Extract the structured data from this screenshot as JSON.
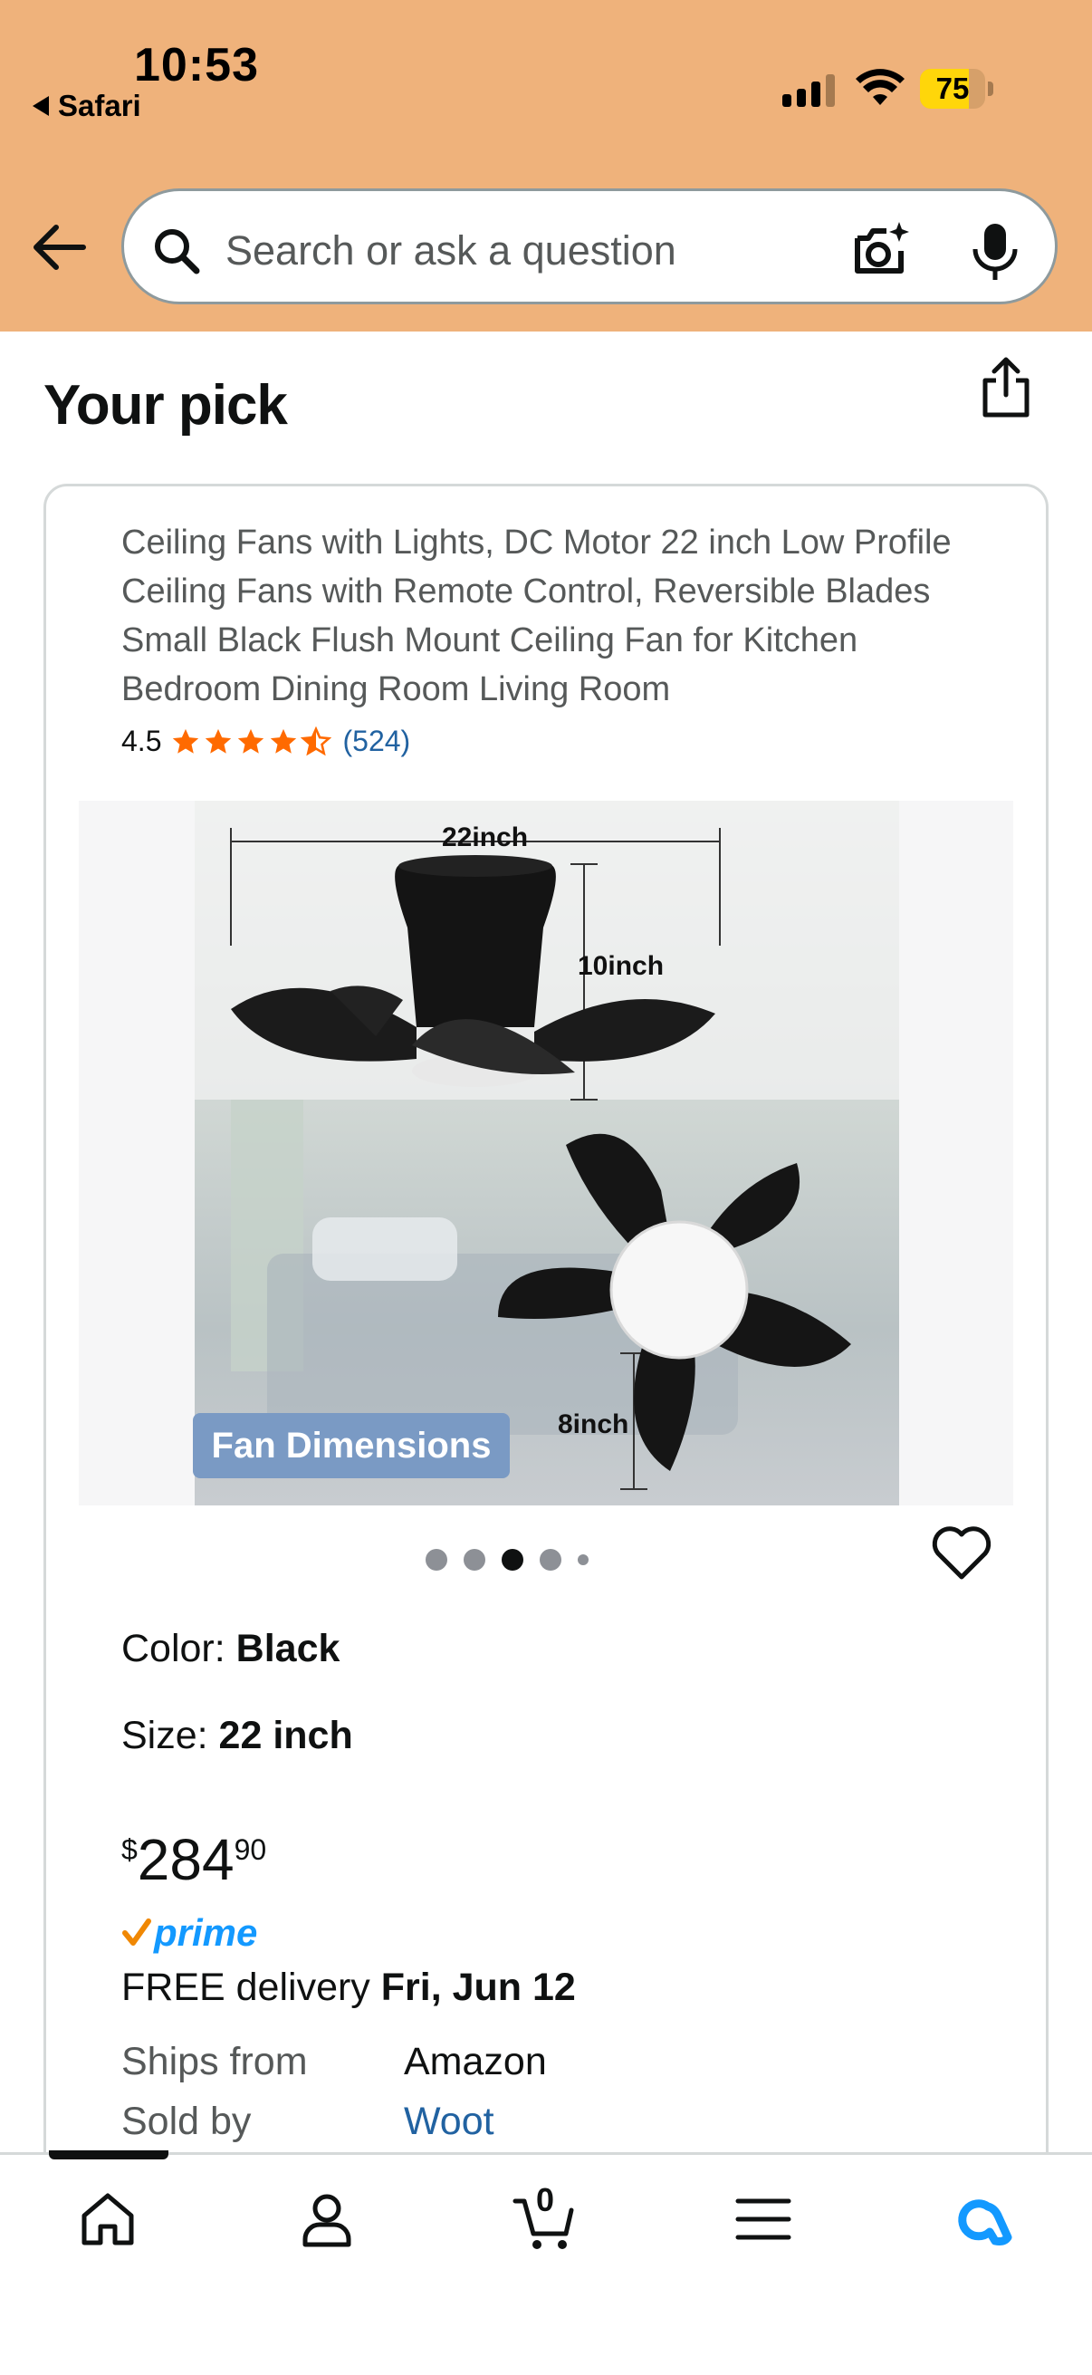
{
  "status_bar": {
    "time": "10:53",
    "back_app": "Safari",
    "battery": "75",
    "battery_level": 0.75
  },
  "search": {
    "placeholder": "Search or ask a question"
  },
  "page": {
    "title": "Your pick"
  },
  "product": {
    "title": "Ceiling Fans with Lights, DC Motor 22 inch Low Profile Ceiling Fans with Remote Control, Reversible Blades Small Black Flush Mount Ceiling Fan for Kitchen Bedroom Dining Room Living Room",
    "rating": "4.5",
    "rating_value": 4.5,
    "review_count": "(524)",
    "image": {
      "overlay_label": "Fan Dimensions",
      "dim_width": "22inch",
      "dim_height": "10inch",
      "dim_blade": "8inch",
      "carousel_count": 5,
      "carousel_active": 3
    },
    "color_label": "Color: ",
    "color_value": "Black",
    "size_label": "Size: ",
    "size_value": "22 inch",
    "price": {
      "symbol": "$",
      "whole": "284",
      "fraction": "90"
    },
    "prime_label": "prime",
    "delivery_label": "FREE delivery ",
    "delivery_date": "Fri, Jun 12",
    "ships_from_label": "Ships from",
    "ships_from_value": "Amazon",
    "sold_by_label": "Sold by",
    "sold_by_value": "Woot"
  },
  "tabbar": {
    "cart_count": "0",
    "items": [
      "home-icon",
      "account-icon",
      "cart-icon",
      "menu-icon",
      "rufus-icon"
    ]
  },
  "colors": {
    "header_bg": "#efb27b",
    "star": "#ff6a00",
    "link": "#2162a1",
    "prime": "#1399ff",
    "rufus": "#1399ff"
  }
}
